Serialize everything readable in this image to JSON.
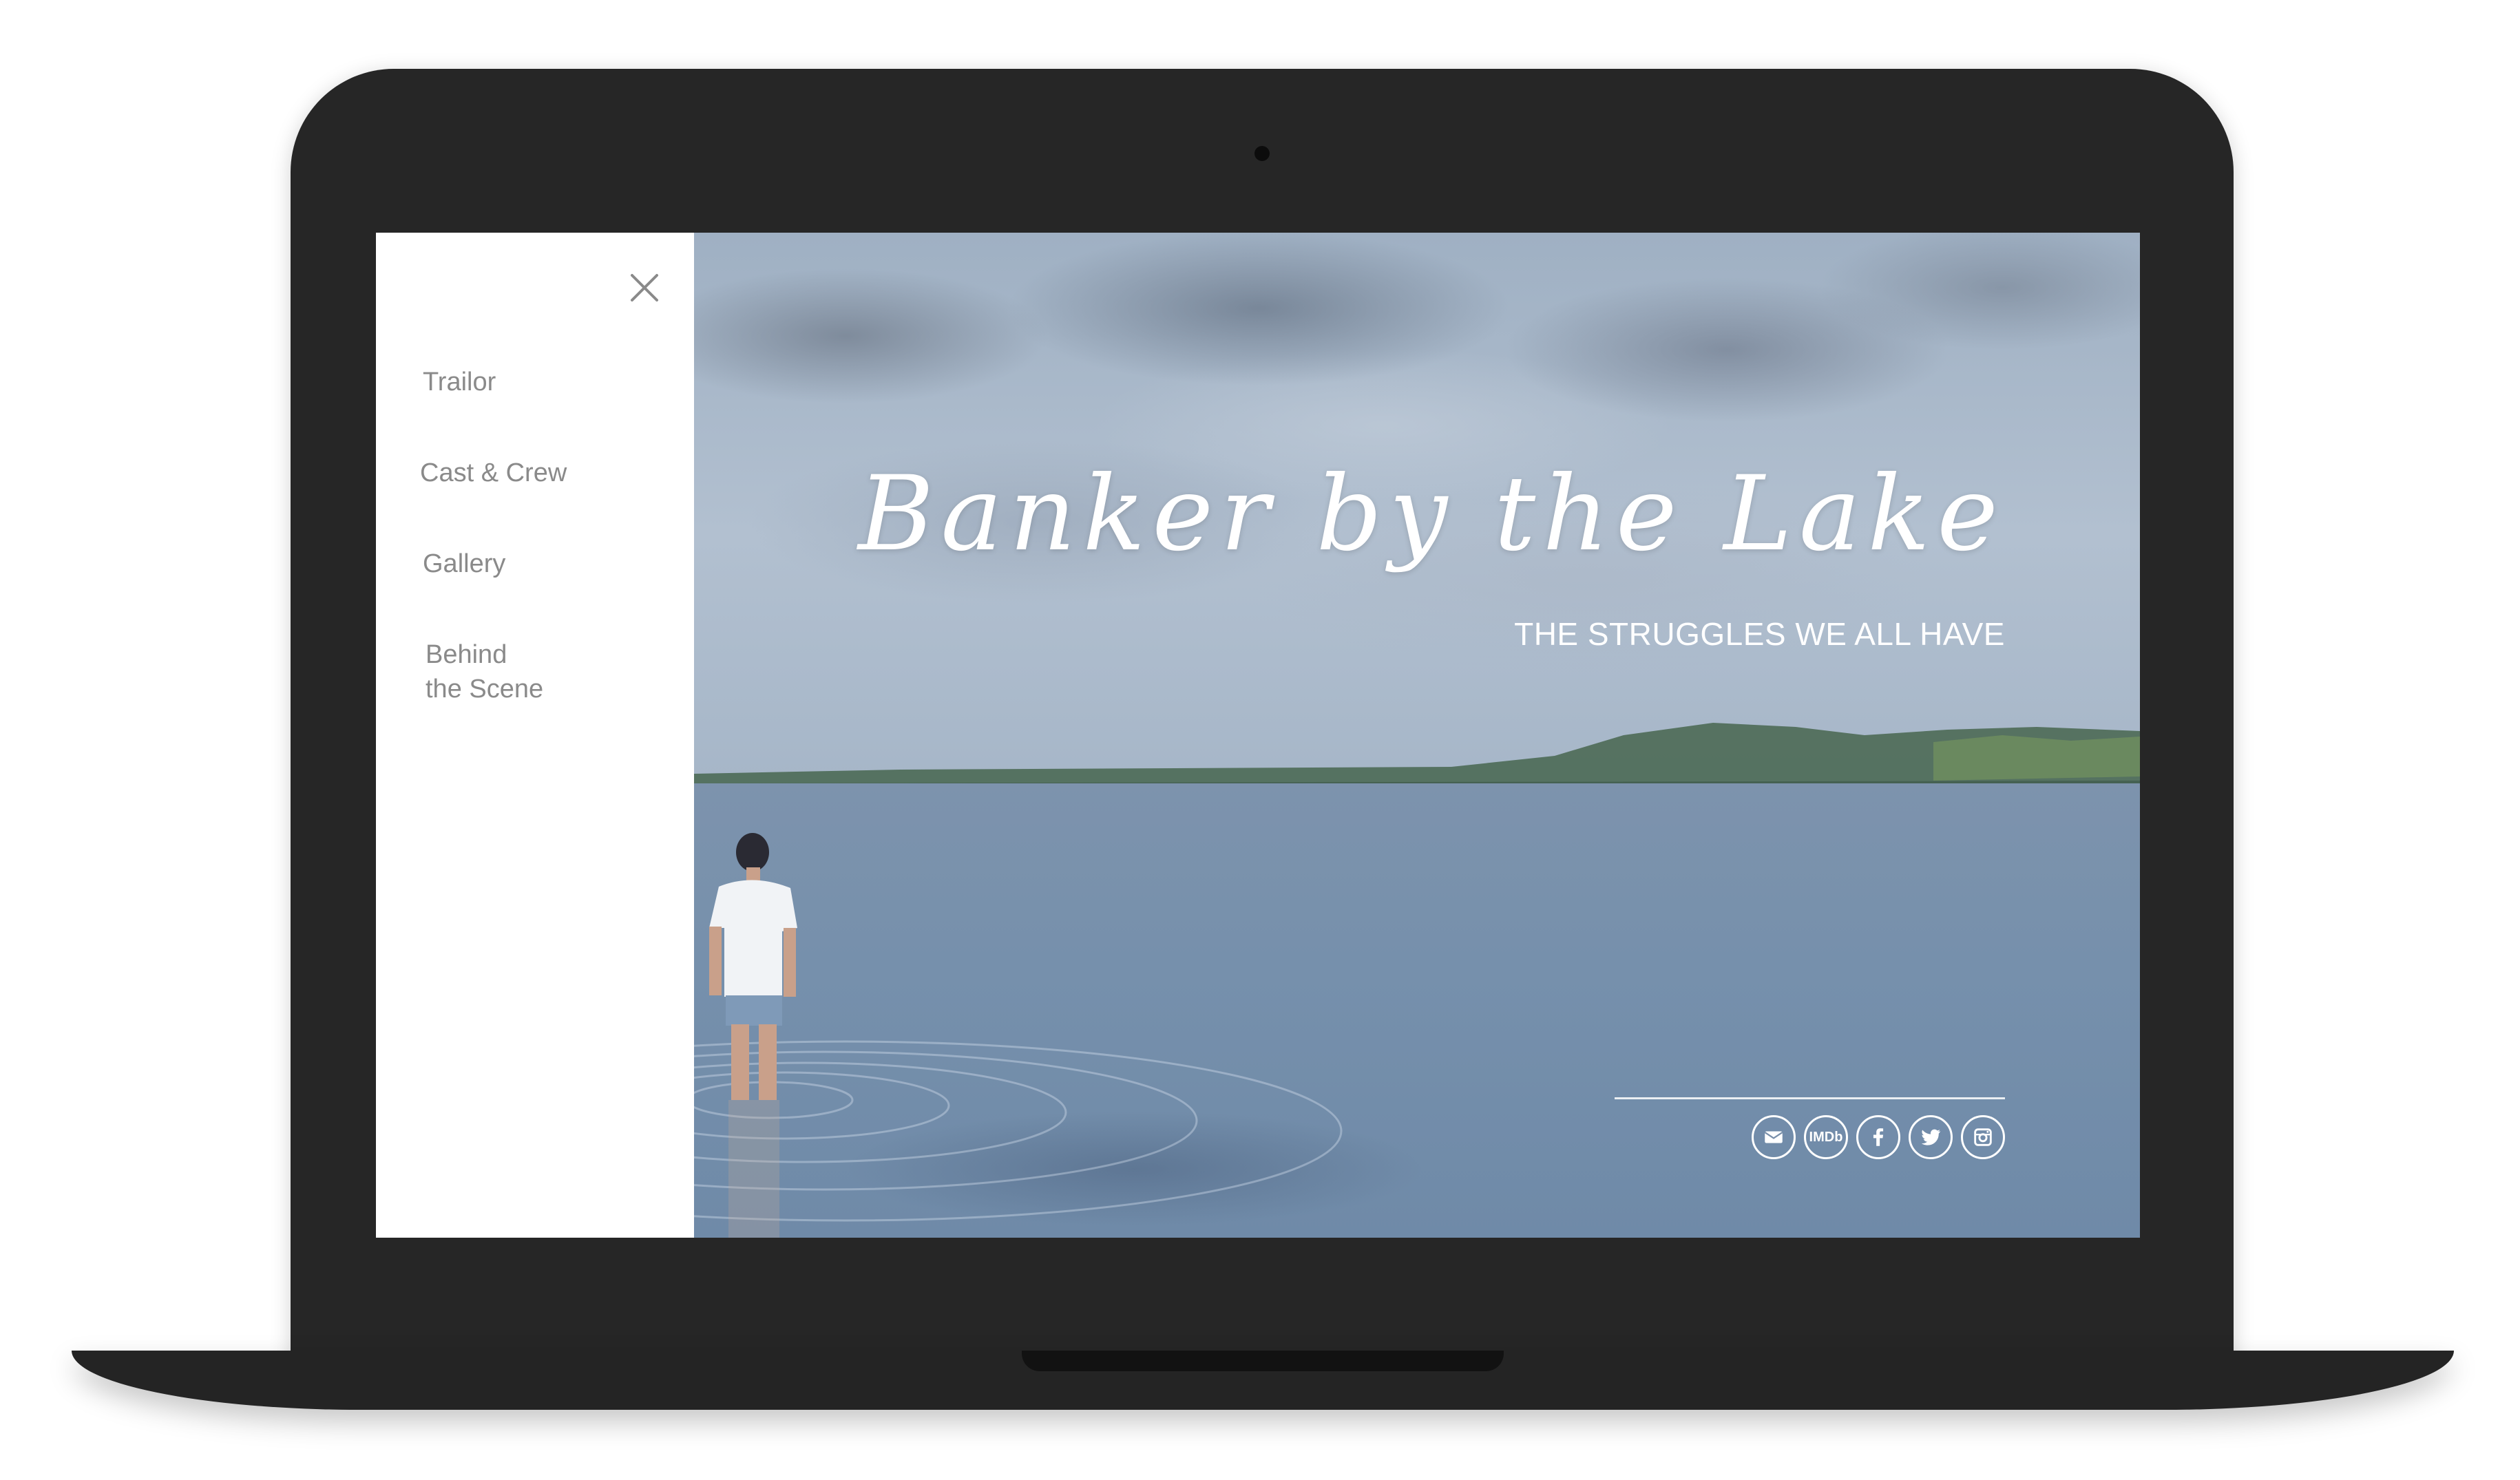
{
  "menu": {
    "close_icon": "close-icon",
    "items": [
      {
        "label": "Trailor"
      },
      {
        "label": "Cast & Crew"
      },
      {
        "label": "Gallery"
      },
      {
        "label": "Behind\nthe Scene"
      }
    ]
  },
  "hero": {
    "title": "Banker by the Lake",
    "subtitle": "THE STRUGGLES WE ALL HAVE",
    "social": [
      {
        "icon": "email-icon"
      },
      {
        "icon": "imdb-icon",
        "label": "IMDb"
      },
      {
        "icon": "facebook-icon"
      },
      {
        "icon": "twitter-icon"
      },
      {
        "icon": "instagram-icon"
      }
    ]
  },
  "colors": {
    "laptop": "#262626",
    "menu_background": "#ffffff",
    "menu_text": "#8a8a8a",
    "overlay_text": "#ffffff"
  }
}
